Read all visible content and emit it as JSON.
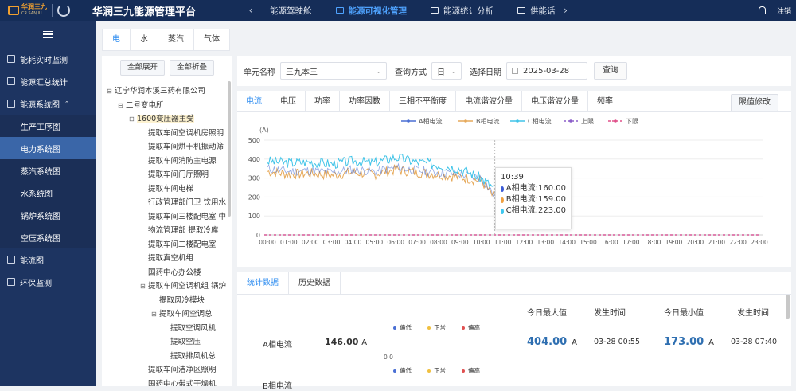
{
  "header": {
    "logo_cn": "华润三九",
    "logo_en": "CR SANJIU",
    "title": "华润三九能源管理平台",
    "nav": [
      {
        "label": "能源驾驶舱",
        "active": false
      },
      {
        "label": "能源可视化管理",
        "active": true
      },
      {
        "label": "能源统计分析",
        "active": false
      },
      {
        "label": "供能话",
        "active": false
      }
    ],
    "logout": "注销"
  },
  "sidebar": {
    "items": [
      {
        "label": "能耗实时监测",
        "type": "item"
      },
      {
        "label": "能源汇总统计",
        "type": "item"
      },
      {
        "label": "能源系统图",
        "type": "item",
        "expanded": true
      },
      {
        "label": "生产工序图",
        "type": "sub"
      },
      {
        "label": "电力系统图",
        "type": "sub",
        "active": true
      },
      {
        "label": "蒸汽系统图",
        "type": "sub"
      },
      {
        "label": "水系统图",
        "type": "sub"
      },
      {
        "label": "锅炉系统图",
        "type": "sub"
      },
      {
        "label": "空压系统图",
        "type": "sub"
      },
      {
        "label": "能流图",
        "type": "item"
      },
      {
        "label": "环保监测",
        "type": "item"
      }
    ]
  },
  "energy_tabs": [
    "电",
    "水",
    "蒸汽",
    "气体"
  ],
  "tree": {
    "expand_all": "全部展开",
    "collapse_all": "全部折叠",
    "nodes": [
      {
        "label": "辽宁华润本溪三药有限公司",
        "level": 0,
        "toggle": "⊟"
      },
      {
        "label": "二号变电所",
        "level": 1,
        "toggle": "⊟"
      },
      {
        "label": "1600变压器主受",
        "level": 2,
        "toggle": "⊟",
        "highlight": true
      },
      {
        "label": "提取车间空调机房照明",
        "level": 3,
        "toggle": ""
      },
      {
        "label": "提取车间烘干机振动筛",
        "level": 3,
        "toggle": ""
      },
      {
        "label": "提取车间消防主电源",
        "level": 3,
        "toggle": ""
      },
      {
        "label": "提取车间门厅照明",
        "level": 3,
        "toggle": ""
      },
      {
        "label": "提取车间电梯",
        "level": 3,
        "toggle": ""
      },
      {
        "label": "行政管理部门卫 饮用水",
        "level": 3,
        "toggle": ""
      },
      {
        "label": "提取车间三楼配电室 中",
        "level": 3,
        "toggle": ""
      },
      {
        "label": "物流管理部 提取冷库",
        "level": 3,
        "toggle": ""
      },
      {
        "label": "提取车间二楼配电室",
        "level": 3,
        "toggle": ""
      },
      {
        "label": "提取真空机组",
        "level": 3,
        "toggle": ""
      },
      {
        "label": "国药中心办公楼",
        "level": 3,
        "toggle": ""
      },
      {
        "label": "提取车间空调机组 锅炉",
        "level": 3,
        "toggle": "⊟"
      },
      {
        "label": "提取风冷模块",
        "level": 4,
        "toggle": ""
      },
      {
        "label": "提取车间空调总",
        "level": 4,
        "toggle": "⊟"
      },
      {
        "label": "提取空调风机",
        "level": 5,
        "toggle": ""
      },
      {
        "label": "提取空压",
        "level": 5,
        "toggle": ""
      },
      {
        "label": "提取排风机总",
        "level": 5,
        "toggle": ""
      },
      {
        "label": "提取车间洁净区照明",
        "level": 3,
        "toggle": ""
      },
      {
        "label": "国药中心带式干燥机",
        "level": 3,
        "toggle": ""
      }
    ]
  },
  "query": {
    "unit_label": "单元名称",
    "unit_value": "三九本三",
    "method_label": "查询方式",
    "method_value": "日",
    "date_label": "选择日期",
    "date_value": "2025-03-28",
    "query_button": "查询"
  },
  "metric_tabs": [
    {
      "label": "电流",
      "active": true
    },
    {
      "label": "电压"
    },
    {
      "label": "功率"
    },
    {
      "label": "功率因数"
    },
    {
      "label": "三相不平衡度"
    },
    {
      "label": "电流谐波分量"
    },
    {
      "label": "电压谐波分量"
    },
    {
      "label": "频率"
    }
  ],
  "limit_button": "限值修改",
  "chart_data": {
    "type": "line",
    "ylabel": "(A)",
    "ylim": [
      0,
      500
    ],
    "yticks": [
      0,
      100,
      200,
      300,
      400,
      500
    ],
    "x": [
      "00:00",
      "01:00",
      "02:00",
      "03:00",
      "04:00",
      "05:00",
      "06:00",
      "07:00",
      "08:00",
      "09:00",
      "10:00",
      "11:00",
      "12:00",
      "13:00",
      "14:00",
      "15:00",
      "16:00",
      "17:00",
      "18:00",
      "19:00",
      "20:00",
      "21:00",
      "22:00",
      "23:00"
    ],
    "series": [
      {
        "name": "A相电流",
        "color": "#4a6fd4",
        "values": [
          350,
          335,
          340,
          330,
          345,
          335,
          355,
          340,
          330,
          320,
          300,
          150
        ]
      },
      {
        "name": "B相电流",
        "color": "#e6a95a",
        "values": [
          335,
          320,
          325,
          315,
          330,
          320,
          345,
          330,
          320,
          305,
          285,
          135
        ]
      },
      {
        "name": "C相电流",
        "color": "#40c4e8",
        "values": [
          390,
          380,
          385,
          375,
          390,
          380,
          410,
          385,
          370,
          350,
          300,
          210
        ]
      },
      {
        "name": "上限",
        "color": "#8b5ec9",
        "values": [
          0,
          0,
          0,
          0,
          0,
          0,
          0,
          0,
          0,
          0,
          0,
          0,
          0,
          0,
          0,
          0,
          0,
          0,
          0,
          0,
          0,
          0,
          0,
          0
        ]
      },
      {
        "name": "下限",
        "color": "#e0508a",
        "values": [
          0,
          0,
          0,
          0,
          0,
          0,
          0,
          0,
          0,
          0,
          0,
          0,
          0,
          0,
          0,
          0,
          0,
          0,
          0,
          0,
          0,
          0,
          0,
          0
        ]
      }
    ],
    "legend_position": "top-center",
    "tooltip": {
      "time": "10:39",
      "rows": [
        {
          "label": "A相电流:160.00",
          "color": "#3b5bd6"
        },
        {
          "label": "B相电流:159.00",
          "color": "#f0a040"
        },
        {
          "label": "C相电流:223.00",
          "color": "#3ec7ee"
        }
      ]
    }
  },
  "stats": {
    "tabs": [
      {
        "label": "统计数据",
        "active": true
      },
      {
        "label": "历史数据"
      }
    ],
    "headers": {
      "max": "今日最大值",
      "max_time": "发生时间",
      "min": "今日最小值",
      "min_time": "发生时间"
    },
    "legend": [
      "偏低",
      "正常",
      "偏高"
    ],
    "legend_colors": [
      "#4a6fd4",
      "#f0c040",
      "#e05050"
    ],
    "zero_label": "0 0",
    "rows": [
      {
        "name": "A相电流",
        "value": "146.00",
        "unit": "A",
        "max": "404.00",
        "max_unit": "A",
        "max_time": "03-28 00:55",
        "min": "173.00",
        "min_unit": "A",
        "min_time": "03-28 07:40"
      },
      {
        "name": "B相电流",
        "value": "",
        "unit": ""
      }
    ]
  }
}
